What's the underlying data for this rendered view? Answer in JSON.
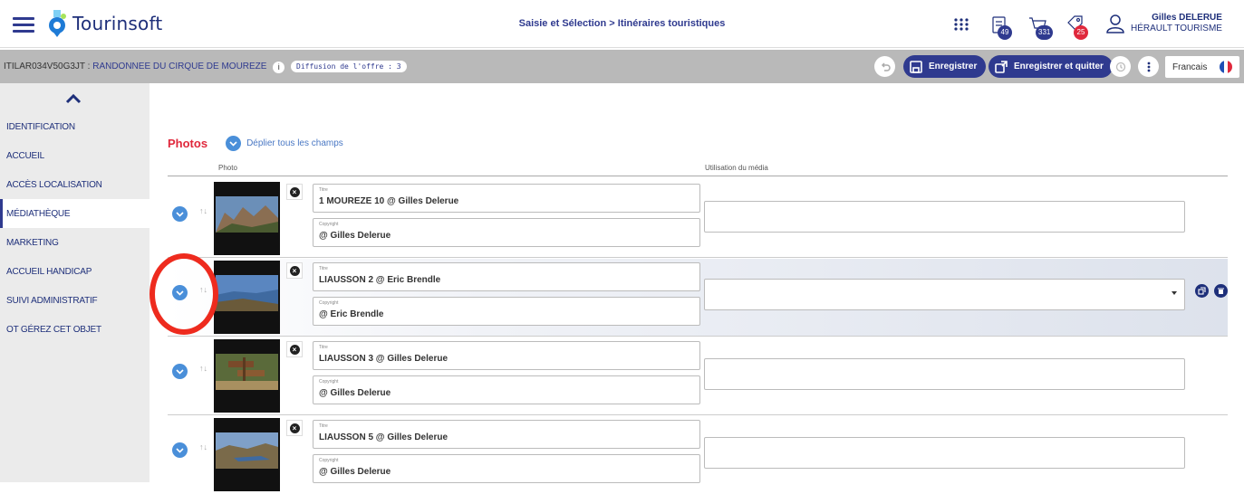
{
  "header": {
    "logo_text": "Tourinsoft",
    "breadcrumb": "Saisie et Sélection > Itinéraires touristiques",
    "badges": {
      "checklist": "49",
      "cart": "331",
      "tag": "25"
    },
    "user_name": "Gilles DELERUE",
    "user_org": "HÉRAULT TOURISME"
  },
  "offer_bar": {
    "code": "ITILAR034V50G3JT",
    "separator": " : ",
    "name": "RANDONNEE DU CIRQUE DE MOUREZE",
    "info": "i",
    "diffusion": "Diffusion de l'offre : 3",
    "save_label": "Enregistrer",
    "save_quit_label": "Enregistrer et quitter",
    "language": "Francais"
  },
  "sidebar": {
    "items": [
      {
        "label": "IDENTIFICATION"
      },
      {
        "label": "ACCUEIL"
      },
      {
        "label": "ACCÈS LOCALISATION"
      },
      {
        "label": "MÉDIATHÈQUE"
      },
      {
        "label": "MARKETING"
      },
      {
        "label": "ACCUEIL HANDICAP"
      },
      {
        "label": "SUIVI ADMINISTRATIF"
      },
      {
        "label": "OT GÉREZ CET OBJET"
      }
    ],
    "active_index": 3
  },
  "main": {
    "section_title": "Photos",
    "expand_all": "Déplier tous les champs",
    "col_photo": "Photo",
    "col_usage": "Utilisation du média",
    "title_label": "Titre",
    "copyright_label": "Copyright",
    "rows": [
      {
        "title": "1 MOUREZE  10 @ Gilles Delerue",
        "copyright": "@ Gilles Delerue"
      },
      {
        "title": "LIAUSSON  2 @ Eric Brendle",
        "copyright": "@ Eric Brendle"
      },
      {
        "title": "LIAUSSON  3 @ Gilles Delerue",
        "copyright": "@ Gilles Delerue"
      },
      {
        "title": "LIAUSSON  5 @ Gilles Delerue",
        "copyright": "@ Gilles Delerue"
      }
    ]
  },
  "colors": {
    "brand": "#2f3a8f",
    "accent_red": "#e0283c",
    "chevron_blue": "#4a8fd9",
    "highlight_ring": "#ee2b1e"
  }
}
